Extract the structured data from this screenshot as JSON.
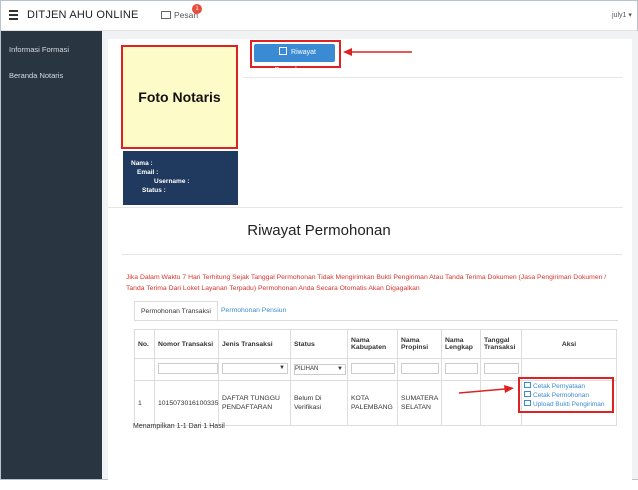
{
  "header": {
    "title": "DITJEN AHU ONLINE",
    "pesan_label": "Pesan",
    "pesan_count": "1",
    "user": "july1"
  },
  "sidebar": {
    "items": [
      {
        "label": "Informasi Formasi"
      },
      {
        "label": "Beranda Notaris"
      }
    ]
  },
  "profile": {
    "photo_placeholder": "Foto Notaris",
    "nama_label": "Nama :",
    "email_label": "Email :",
    "username_label": "Username :",
    "status_label": "Status :"
  },
  "riwayat_button": "Riwayat Permohonan",
  "page_heading": "Riwayat Permohonan",
  "warning": "Jika Dalam Waktu 7 Hari Terhitung Sejak Tanggal Permohonan Tidak Mengirimkan Bukti Pengiriman Atau Tanda Terima Dokumen (Jasa Pengiriman Dokumen / Tanda Terima Dari Loket Layanan Terpadu) Permohonan Anda Secara Otomatis Akan Digagalkan",
  "tabs": [
    {
      "label": "Permohonan Transaksi",
      "active": true
    },
    {
      "label": "Permohonan Pensiun",
      "active": false
    }
  ],
  "table": {
    "headers": [
      "No.",
      "Nomor Transaksi",
      "Jenis Transaksi",
      "Status",
      "Nama Kabupaten",
      "Nama Propinsi",
      "Nama Lengkap",
      "Tanggal Transaksi",
      "Aksi"
    ],
    "status_filter": "PILIHAN",
    "rows": [
      {
        "no": "1",
        "nomor": "1015073016100335",
        "jenis": "DAFTAR TUNGGU PENDAFTARAN",
        "status": "Belum Di Verifikasi",
        "kabupaten": "KOTA PALEMBANG",
        "propinsi": "SUMATERA SELATAN",
        "nama": "",
        "tanggal": ""
      }
    ],
    "actions": [
      "Cetak Pernyataan",
      "Cetak Permohonan",
      "Upload Bukti Pengiriman"
    ]
  },
  "summary": "Menampilkan 1-1 Dari 1 Hasil",
  "colors": {
    "sidebar": "#2a3542",
    "profile": "#1f3a5e",
    "primary": "#3a8bd3",
    "warning": "#d9342b",
    "highlight": "#dd2222"
  }
}
